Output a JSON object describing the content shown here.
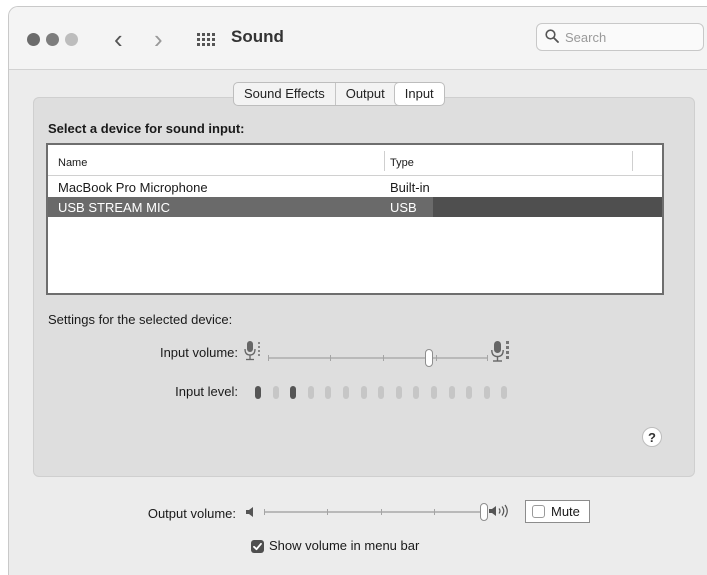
{
  "window": {
    "title": "Sound",
    "nav_back_glyph": "‹",
    "nav_forward_glyph": "›",
    "icons": [
      "back-arrow-icon",
      "forward-arrow-icon",
      "grid-icon",
      "search-icon"
    ]
  },
  "search": {
    "placeholder": "Search"
  },
  "tabs": [
    {
      "label": "Sound Effects",
      "selected": false
    },
    {
      "label": "Output",
      "selected": false
    },
    {
      "label": "Input",
      "selected": true
    }
  ],
  "input_section": {
    "heading": "Select a device for sound input:",
    "columns": {
      "name": "Name",
      "type": "Type"
    },
    "devices": [
      {
        "name": "MacBook Pro Microphone",
        "type": "Built-in",
        "selected": false
      },
      {
        "name": "USB STREAM MIC",
        "type": "USB",
        "selected": true
      }
    ]
  },
  "device_settings": {
    "heading": "Settings for the selected device:",
    "input_volume_label": "Input volume:",
    "input_volume_level": 0.73,
    "input_level_label": "Input level:",
    "input_level_segments_total": 15,
    "input_level_segments_active": [
      1,
      3
    ]
  },
  "help": {
    "label": "?"
  },
  "output": {
    "volume_label": "Output volume:",
    "volume_level": 1.0,
    "mute_label": "Mute",
    "mute_checked": false,
    "show_in_menu_bar_label": "Show volume in menu bar",
    "show_in_menu_bar_checked": true
  },
  "colors": {
    "selected_row": "#4f4f4f",
    "window_bg": "#ececec",
    "panel_bg": "#dedede"
  }
}
